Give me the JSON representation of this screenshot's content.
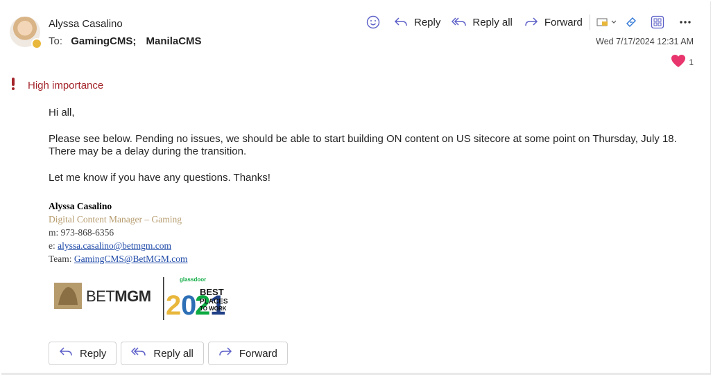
{
  "sender": {
    "name": "Alyssa Casalino"
  },
  "recipients": {
    "label": "To:",
    "list": [
      "GamingCMS;",
      "ManilaCMS"
    ]
  },
  "toolbar": {
    "reply": "Reply",
    "reply_all": "Reply all",
    "forward": "Forward"
  },
  "date": "Wed 7/17/2024 12:31 AM",
  "reaction": {
    "icon": "heart",
    "count": "1"
  },
  "importance": {
    "label": "High importance",
    "color": "#a4262c"
  },
  "body": {
    "greeting": "Hi all,",
    "p1": "Please see below. Pending no issues, we should be able to start building ON content on US sitecore at some point on Thursday, July 18. There may be a delay during the transition.",
    "p2": "Let me know if you have any questions. Thanks!"
  },
  "signature": {
    "name": "Alyssa Casalino",
    "title": "Digital Content Manager – Gaming",
    "mobile_label": "m:",
    "mobile": "973-868-6356",
    "email_label": "e:",
    "email": "alyssa.casalino@betmgm.com",
    "team_label": "Team:",
    "team": "GamingCMS@BetMGM.com"
  },
  "logo": {
    "brand": "BETMGM",
    "badge_top": "glassdoor",
    "badge_year": "2021",
    "badge_text": [
      "BEST",
      "PLACES",
      "TO WORK"
    ]
  },
  "reply_bar": {
    "reply": "Reply",
    "reply_all": "Reply all",
    "forward": "Forward"
  },
  "colors": {
    "accent": "#5b5fc7",
    "gold": "#b69b6d",
    "link": "#1f4aa8"
  }
}
